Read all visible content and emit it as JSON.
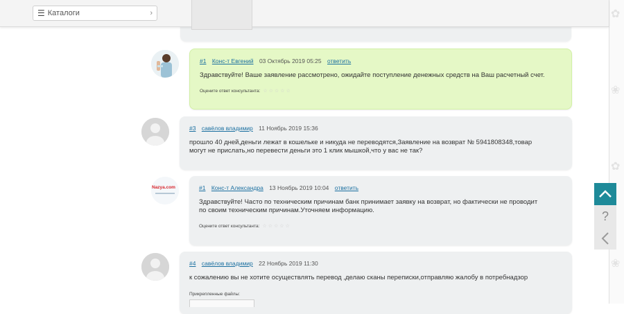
{
  "topbar": {
    "catalog_label": "Каталоги"
  },
  "comments": [
    {
      "number": "#1",
      "author": "Конс-т Евгений",
      "date": "03 Октябрь 2019 05:25",
      "reply": "ответить",
      "text": "Здравствуйте! Ваше заявление рассмотрено, ожидайте поступление денежных средств на Ваш расчетный счет.",
      "rating_label": "Оцените ответ консультанта:"
    },
    {
      "number": "#3",
      "author": "савёлов владимир",
      "date": "11 Ноябрь 2019 15:36",
      "text_line1": "прошло 40 дней,деньги лежат в кошельке и никуда не переводятся,Заявление на возврат № 5941808348,товар",
      "text_line2": "могут не прислать,но перевести деньги это 1 клик мышкой,что у вас не так?"
    },
    {
      "number": "#1",
      "author": "Конс-т Александра",
      "date": "13 Ноябрь 2019 10:04",
      "reply": "ответить",
      "text_line1": "Здравствуйте! Часто по техническим причинам банк принимает заявку на возврат, но фактически не проводит",
      "text_line2": "по своим техническим причинам.Уточняем информацию.",
      "rating_label": "Оцените ответ консультанта:",
      "avatar_logo": "Nazya.com"
    },
    {
      "number": "#4",
      "author": "савёлов владимир",
      "date": "22 Ноябрь 2019 11:30",
      "text": "к сожалению вы не хотите осуществлять перевод ,делаю сканы переписки,отправляю жалобу в потребнадзор",
      "attachments_label": "Прикрепленные файлы:"
    }
  ],
  "side_widget": {
    "up_icon": "chevron-up-icon",
    "help_glyph": "?",
    "back_icon": "chevron-left-icon"
  },
  "colors": {
    "accent_teal": "#1e8a99",
    "link_blue": "#1a6fa0",
    "consultant_bubble": "#e5f8c6",
    "user_bubble": "#eef0f1"
  }
}
